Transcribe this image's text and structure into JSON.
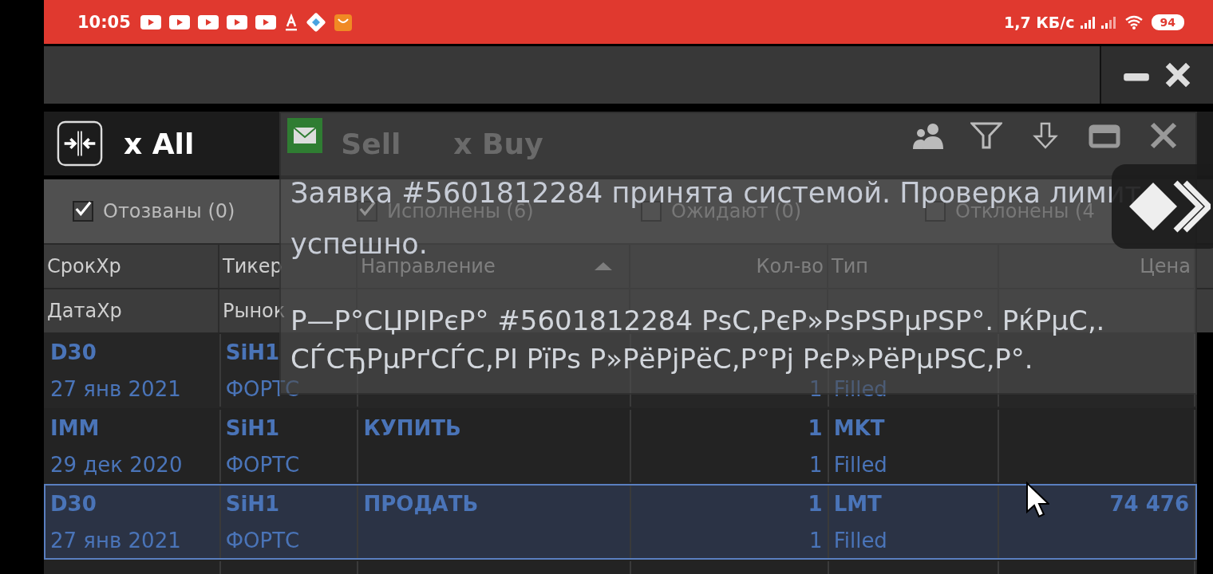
{
  "status_bar": {
    "time": "10:05",
    "speed": "1,7 КБ/с",
    "battery": "94"
  },
  "tabs": [
    {
      "label": "x All",
      "selected": true
    },
    {
      "label": "Sell",
      "selected": false
    },
    {
      "label": "x Buy",
      "selected": false
    }
  ],
  "filters": [
    {
      "label": "Отозваны (0)",
      "checked": true
    },
    {
      "label": "Исполнены (6)",
      "checked": true
    },
    {
      "label": "Ожидают (0)",
      "checked": false
    },
    {
      "label": "Отклонены (4",
      "checked": false
    }
  ],
  "columns": [
    {
      "top": "СрокХр",
      "bottom": "ДатаХр",
      "kind": "text",
      "sorted": false
    },
    {
      "top": "Тикер",
      "bottom": "Рынок",
      "kind": "text",
      "sorted": false
    },
    {
      "top": "Направление",
      "kind": "text",
      "sorted": true
    },
    {
      "top": "Кол-во",
      "kind": "number",
      "sorted": false
    },
    {
      "top": "Тип",
      "kind": "text",
      "sorted": false
    },
    {
      "top": "Цена",
      "kind": "number",
      "sorted": false
    }
  ],
  "rows": [
    {
      "selected": false,
      "cells": [
        [
          "D30",
          "27 янв 2021"
        ],
        [
          "SiH1",
          "ФОРТС"
        ],
        [
          "",
          ""
        ],
        [
          "",
          "1"
        ],
        [
          "",
          "Filled"
        ],
        [
          "",
          ""
        ]
      ]
    },
    {
      "selected": false,
      "cells": [
        [
          "IMM",
          "29 дек 2020"
        ],
        [
          "SiH1",
          "ФОРТС"
        ],
        [
          "КУПИТЬ",
          ""
        ],
        [
          "1",
          "1"
        ],
        [
          "MKT",
          "Filled"
        ],
        [
          "",
          ""
        ]
      ]
    },
    {
      "selected": true,
      "cells": [
        [
          "D30",
          "27 янв 2021"
        ],
        [
          "SiH1",
          "ФОРТС"
        ],
        [
          "ПРОДАТЬ",
          ""
        ],
        [
          "1",
          "1"
        ],
        [
          "LMT",
          "Filled"
        ],
        [
          "74 476",
          ""
        ]
      ]
    },
    {
      "selected": false,
      "cells": [
        [
          "",
          ""
        ],
        [
          "",
          ""
        ],
        [
          "",
          ""
        ],
        [
          "",
          ""
        ],
        [
          "",
          ""
        ],
        [
          "",
          ""
        ]
      ]
    }
  ],
  "dialog": {
    "message": [
      "Заявка #5601812284 принята системой. Проверка лимит",
      "успешно."
    ],
    "garbled": [
      "Р—Р°СЏРІРєР° #5601812284 РѕС‚РєР»РѕРЅРµРЅР°. РќРµС‚.",
      "СЃСЂРµРґСЃС‚РІ РїРѕ Р»РёРјРёС‚Р°Рј РєР»РёРµРЅС‚Р°."
    ]
  }
}
